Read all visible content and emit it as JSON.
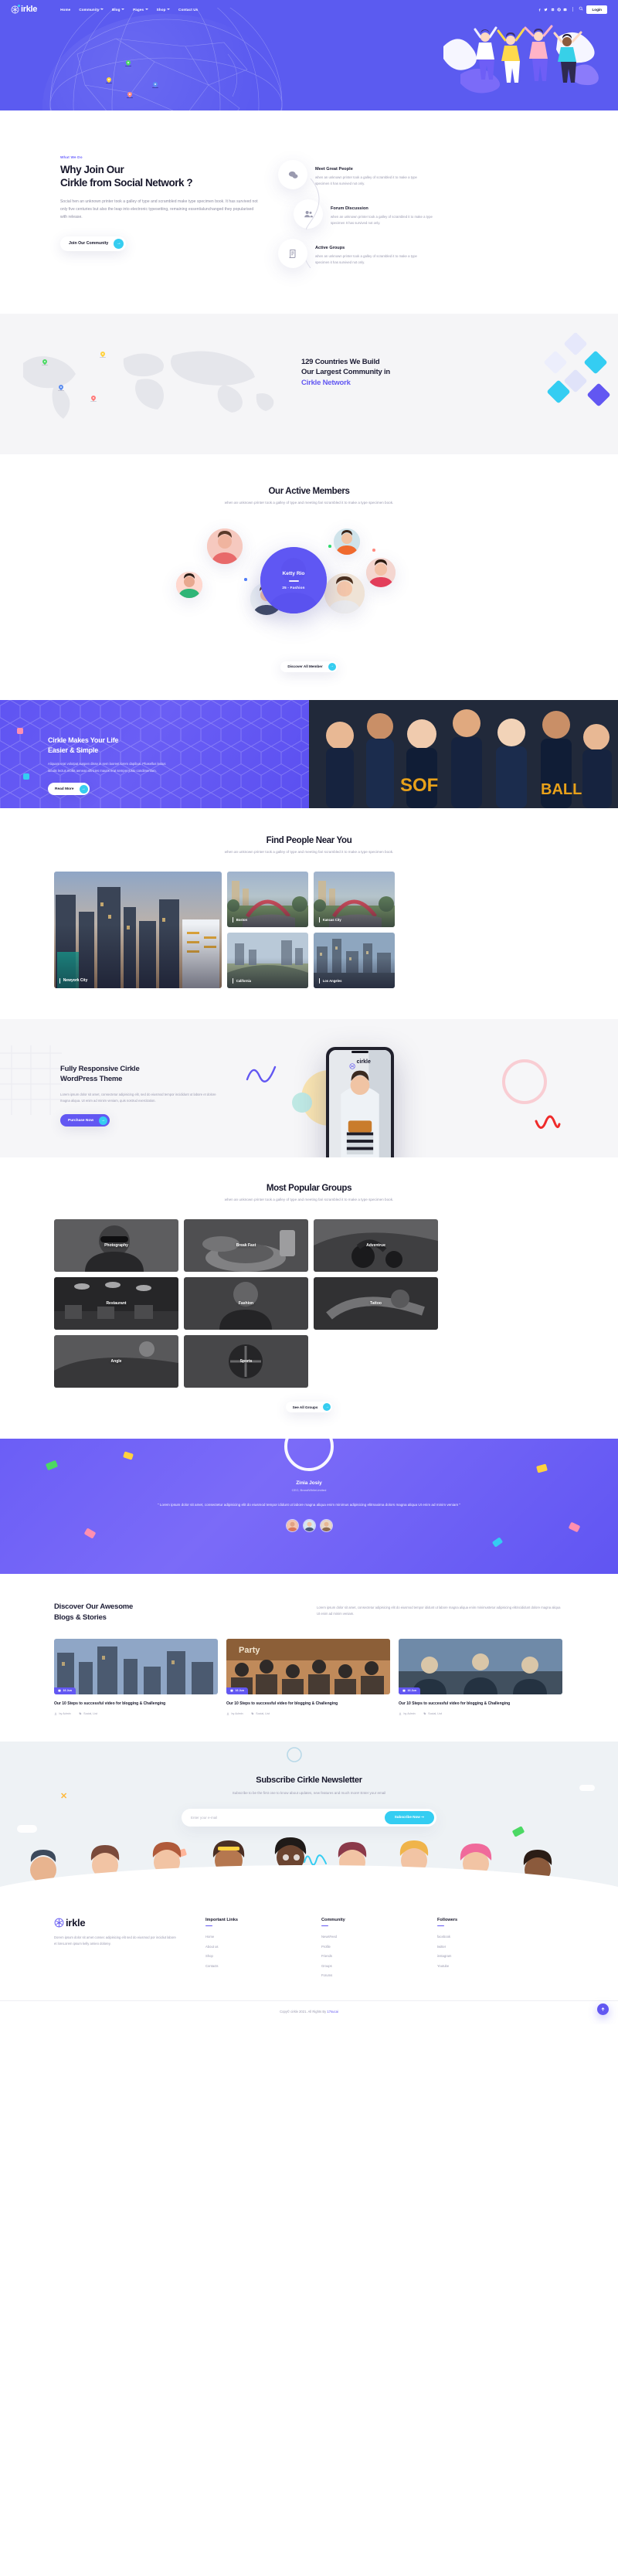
{
  "brand": {
    "name": "irkle",
    "full": "cirkle"
  },
  "header": {
    "nav": [
      {
        "label": "Home",
        "caret": false
      },
      {
        "label": "Community",
        "caret": true
      },
      {
        "label": "Blog",
        "caret": true
      },
      {
        "label": "Pages",
        "caret": true
      },
      {
        "label": "Shop",
        "caret": true
      },
      {
        "label": "Contact Us",
        "caret": false
      }
    ],
    "socials": [
      "facebook-icon",
      "twitter-icon",
      "linkedin-icon",
      "pinterest-icon",
      "behance-icon"
    ],
    "social_glyphs": [
      "f",
      "❈",
      "in",
      "p",
      "ƀ"
    ],
    "search_icon": "search-icon",
    "login_label": "Login"
  },
  "why_join": {
    "eyebrow": "What We Do",
    "title_line1": "Why Join Our",
    "title_line2": "Cirkle from Social Network ?",
    "paragraph": "Social hen an unknown printer took a galley of type and scrambled make type specimen book. It has survived not only five centuries but also the leap into electronic typesetting, remaining essentialunchanged they popularised with release.",
    "cta": "Join Our Community",
    "features": [
      {
        "icon": "chat-bubbles-icon",
        "title": "Meet Great People",
        "text": "when an unknown printer took a galley of scrambled it to make a type specimen it has survived not only."
      },
      {
        "icon": "people-group-icon",
        "title": "Forum Discussion",
        "text": "when an unknown printer took a galley of scrambled it to make a type specimen It has survived not only."
      },
      {
        "icon": "document-icon",
        "title": "Active Groups",
        "text": "when an unknown printer took a galley of scrambled it to make a type specimen it has survived not only."
      }
    ]
  },
  "countries": {
    "line1": "129 Countries We Build",
    "line2": "Our Largest Community in",
    "accent": "Cirkle Network",
    "pin_colors": [
      "#4cd964",
      "#ffd23f",
      "#ff7a7a",
      "#5b8def"
    ],
    "diamond_colors": [
      "#e7e9ff",
      "#34cdf2",
      "#d8dbf7",
      "#6257f2"
    ]
  },
  "members": {
    "title": "Our Active Members",
    "subtitle": "when an unknown printer took a galley of type and meeting fari scrambled it to make a type specimen book.",
    "featured": {
      "name": "Ketty Rio",
      "meta": "25 - Fashion"
    },
    "cta": "Discover All Member",
    "avatar_colors": [
      "#f4b9b0",
      "#bcdce4",
      "#f0e0cf",
      "#f3c4ad",
      "#e8d7c6",
      "#d6e7ef",
      "#f5cfc4",
      "#ead4c8"
    ]
  },
  "makes": {
    "title_line1": "Cirkle Makes Your Life",
    "title_line2": "Easier & Simple",
    "paragraph": "Aliquam erat volutpat suspen disse in sem laoreet lorem dapibus. Phasellus lectus iaculis lectus mollis aenean ultricies mauris erat semper justo condimentum.",
    "cta": "Read More"
  },
  "find_people": {
    "title": "Find People Near You",
    "subtitle": "when an unknown printer took a galley of type and meeting fari scrambled it to make a type specimen book.",
    "cities": [
      {
        "name": "Newyork City",
        "size": "big"
      },
      {
        "name": "Boston",
        "size": "sm"
      },
      {
        "name": "Kancas City",
        "size": "sm"
      },
      {
        "name": "California",
        "size": "sm"
      },
      {
        "name": "Los Angeles",
        "size": "sm"
      }
    ]
  },
  "responsive": {
    "title_line1": "Fully Responsive Cirkle",
    "title_line2": "WordPress Theme",
    "paragraph": "Lorem ipsum dolor sit amet, consectetur adipisicing elit, sed do eiusmod tempor incididunt ut labore et dolore magna aliqua. Ut enim ad minim veniam, quis nostrud exercitation.",
    "cta": "Purchase Now",
    "phone_logo": "cirkle"
  },
  "groups": {
    "title": "Most Popular Groups",
    "subtitle": "when an unknown printer took a galley of type and meeting fari scrambled it to make a type specimen book.",
    "items": [
      {
        "name": "Photography"
      },
      {
        "name": "Break Fast"
      },
      {
        "name": "Adventrue"
      },
      {
        "name": "Restaurant"
      },
      {
        "name": "Fashion"
      },
      {
        "name": "Tattoo"
      },
      {
        "name": "Angle"
      },
      {
        "name": "Sports"
      }
    ],
    "cta": "See All Groups"
  },
  "testimonial": {
    "name": "Zinia Josiy",
    "role": "CEO, BrandWhiteLimited",
    "quote": "\" Lorem ipsum dolor sit amet, consectetur adipisicing elit do eiusmod tempor ididunt ut labore magna aliqua enim minimus adipisicing elitmaxima dolors magna aliqua Ut enim ad minim veniam \"",
    "dot_colors": [
      "#f3c4ad",
      "#d6e7ef",
      "#e8d7c6"
    ]
  },
  "blogs": {
    "title_line1": "Discover Our Awesome",
    "title_line2": "Blogs & Stories",
    "intro": "Lorem ipsum dolor sit amet, consectetur adipisicing elit do eiusmod tempor ididunt ut labore magna aliqua enim minimustetur adipisicing elitincididunt dolore magna aliqua Ut enim ad minim veniam.",
    "posts": [
      {
        "date": "16 Jun",
        "date_icon": "calendar-icon",
        "title": "Our 10 Steps to successful video for blogging & Challenging",
        "author": "by Admin",
        "category": "Social, List"
      },
      {
        "date": "16 Jun",
        "date_icon": "calendar-icon",
        "title": "Our 10 Steps to successful video for blogging & Challenging",
        "author": "by Admin",
        "category": "Social, List"
      },
      {
        "date": "16 Jun",
        "date_icon": "calendar-icon",
        "title": "Our 10 Steps to successful video for blogging & Challenging",
        "author": "by Admin",
        "category": "Social, List"
      }
    ]
  },
  "newsletter": {
    "title": "Subscribe Cirkle Newsletter",
    "subtitle": "Subscribe to be the first one to know about updates, new features and much more! Enter your email",
    "placeholder": "Enter your e-mail",
    "button": "Subscribe Now ⇢"
  },
  "footer": {
    "about": "Dorem ipsum dolor sit amet consec adipisicing elit sed do eiusmod por incidiut labore et loreLorem ipsum kelly amieo dolorey.",
    "columns": [
      {
        "title": "Important Links",
        "links": [
          "Home",
          "About us",
          "Shop",
          "Contacts"
        ]
      },
      {
        "title": "Community",
        "links": [
          "NewsFeed",
          "Profile",
          "Friends",
          "Groups",
          "Forums"
        ]
      },
      {
        "title": "Followers",
        "links": [
          "facebook",
          "twitter",
          "instagram",
          "Youtube"
        ]
      }
    ],
    "copy_prefix": "Copy© cirkle 2021. All Rights By ",
    "copy_link": "17sucai",
    "to_top_icon": "arrow-up-icon"
  }
}
